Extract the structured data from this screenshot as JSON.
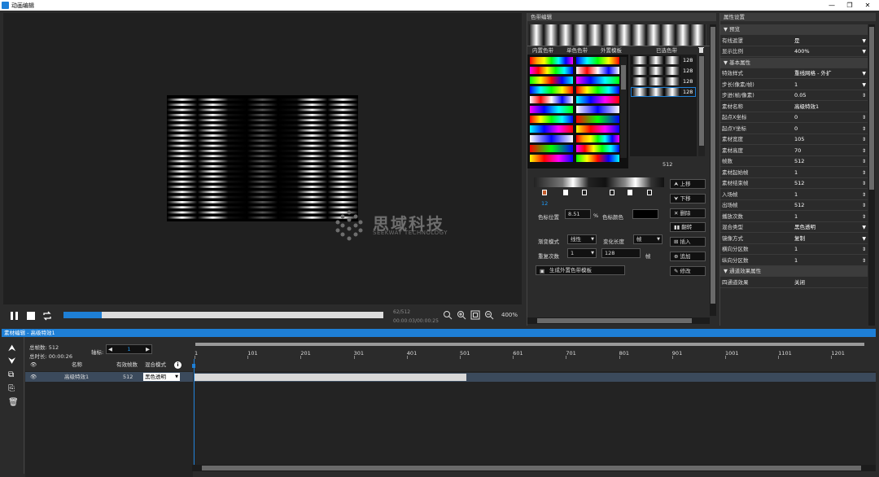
{
  "window": {
    "title": "动画编辑",
    "min": "—",
    "max": "❐",
    "close": "✕"
  },
  "preview": {
    "watermark_cn": "思域科技",
    "watermark_en": "SEEKWAY TECHNOLOGY"
  },
  "transport": {
    "frame_counter": "62/512",
    "time_counter": "00:00:03/00:00:25",
    "zoom": "400%",
    "progress_fraction": 0.12
  },
  "colorband": {
    "title": "色带编辑",
    "tabs": [
      "内置色带",
      "单色色带",
      "外置模板"
    ],
    "selected_title": "已选色带",
    "selected_items": [
      "128",
      "128",
      "128",
      "128"
    ],
    "selected_total": "512",
    "gradient_index": "12",
    "position_label": "色标位置",
    "position_value": "8.51",
    "position_unit": "%",
    "color_label": "色标颜色",
    "gradient_mode_label": "渐变模式",
    "gradient_mode_value": "线性",
    "change_length_label": "变化长度",
    "change_length_value": "帧",
    "repeat_label": "重复次数",
    "repeat_value": "1",
    "frames_value": "128",
    "frames_unit": "帧",
    "generate_btn": "生成外置色带模板",
    "buttons": {
      "up": "上移",
      "down": "下移",
      "delete": "删除",
      "flip": "翻转",
      "insert": "插入",
      "append": "追加",
      "modify": "修改"
    }
  },
  "props": {
    "title": "属性设置",
    "rows": [
      {
        "k": "▼ 预览",
        "v": "",
        "sec": true
      },
      {
        "k": "有线遮罩",
        "v": "是",
        "ar": "▼"
      },
      {
        "k": "显示比例",
        "v": "400%",
        "ar": "▼"
      },
      {
        "k": "▼ 基本属性",
        "v": "",
        "sec": true
      },
      {
        "k": "特效样式",
        "v": "重线网格 - 外扩",
        "ar": "▼"
      },
      {
        "k": "步长(像素/帧)",
        "v": "1",
        "ar": "▼"
      },
      {
        "k": "步进(帧/像素)",
        "v": "0.05",
        "ar": "⇕"
      },
      {
        "k": "素材名称",
        "v": "高级特效1",
        "ar": ""
      },
      {
        "k": "起点X坐标",
        "v": "0",
        "ar": "⇕"
      },
      {
        "k": "起点Y坐标",
        "v": "0",
        "ar": "⇕"
      },
      {
        "k": "素材宽度",
        "v": "105",
        "ar": "⇕"
      },
      {
        "k": "素材高度",
        "v": "70",
        "ar": "⇕"
      },
      {
        "k": "帧数",
        "v": "512",
        "ar": "⇕"
      },
      {
        "k": "素材起始帧",
        "v": "1",
        "ar": "⇕"
      },
      {
        "k": "素材结束帧",
        "v": "512",
        "ar": "⇕"
      },
      {
        "k": "入场帧",
        "v": "1",
        "ar": "⇕"
      },
      {
        "k": "出场帧",
        "v": "512",
        "ar": "⇕"
      },
      {
        "k": "播放次数",
        "v": "1",
        "ar": "⇕"
      },
      {
        "k": "混合类型",
        "v": "黑色透明",
        "ar": "▼"
      },
      {
        "k": "镜像方式",
        "v": "复制",
        "ar": "▼"
      },
      {
        "k": "横向分区数",
        "v": "1",
        "ar": "⇕"
      },
      {
        "k": "纵向分区数",
        "v": "1",
        "ar": "⇕"
      },
      {
        "k": "▼ 通道效果属性",
        "v": "",
        "sec": true
      },
      {
        "k": "四通道效果",
        "v": "关闭",
        "ar": ""
      }
    ]
  },
  "timeline": {
    "header": "素材编辑 - 高级特效1",
    "total_frames": "总帧数: 512",
    "total_time": "总时长: 00:00:26",
    "axis_label": "轴标:",
    "axis_value": "1",
    "col_name": "名称",
    "col_frames": "有效帧数",
    "col_blend": "混合模式",
    "layer_name": "高级特效1",
    "layer_frames": "512",
    "layer_blend": "黑色透明",
    "ruler_ticks": [
      "1",
      "101",
      "201",
      "301",
      "401",
      "501",
      "601",
      "701",
      "801",
      "901",
      "1001",
      "1101",
      "1201"
    ]
  }
}
